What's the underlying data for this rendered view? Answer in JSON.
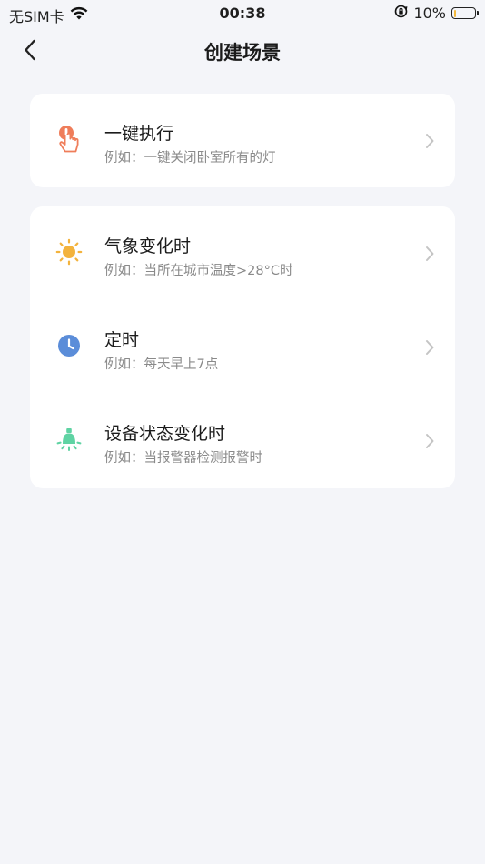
{
  "status_bar": {
    "carrier": "无SIM卡",
    "time": "00:38",
    "battery": "10%",
    "battery_level": 0.1,
    "battery_color": "#f3b83b"
  },
  "nav": {
    "title": "创建场景"
  },
  "sections": [
    {
      "items": [
        {
          "title": "一键执行",
          "subtitle": "例如：一键关闭卧室所有的灯",
          "icon": "hand-tap-icon",
          "icon_color": "#ef7d5a"
        }
      ]
    },
    {
      "items": [
        {
          "title": "气象变化时",
          "subtitle": "例如：当所在城市温度>28°C时",
          "icon": "sun-icon",
          "icon_color": "#f3b33d"
        },
        {
          "title": "定时",
          "subtitle": "例如：每天早上7点",
          "icon": "clock-icon",
          "icon_color": "#5b8dd9"
        },
        {
          "title": "设备状态变化时",
          "subtitle": "例如：当报警器检测报警时",
          "icon": "bulb-icon",
          "icon_color": "#5fd3a3"
        }
      ]
    }
  ],
  "colors": {
    "background": "#f4f5f9",
    "card": "#ffffff",
    "chevron": "#c4c4c4"
  }
}
